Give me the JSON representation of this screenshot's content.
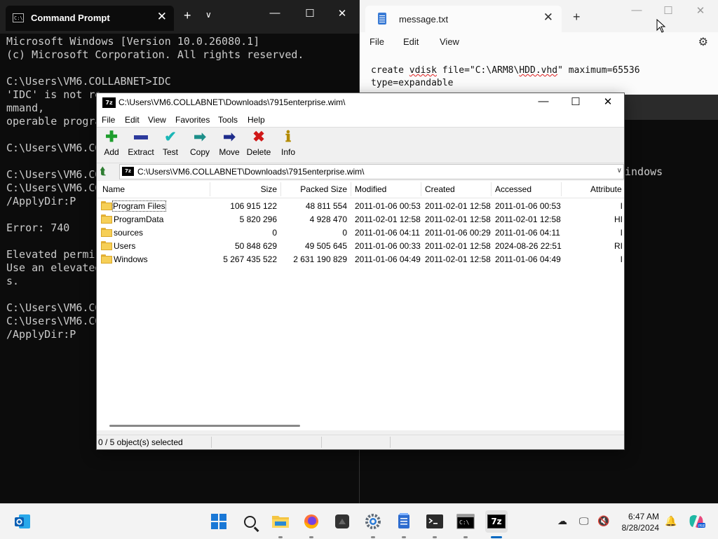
{
  "cmd": {
    "tab_title": "Command Prompt",
    "lines": [
      "Microsoft Windows [Version 10.0.26080.1]",
      "(c) Microsoft Corporation. All rights reserved.",
      "",
      "C:\\Users\\VM6.COLLABNET>IDC",
      "'IDC' is not re",
      "mmand,",
      "operable progra",
      "",
      "C:\\Users\\VM6.CO",
      "",
      "C:\\Users\\VM6.CO",
      "C:\\Users\\VM6.CO",
      "/ApplyDir:P",
      "",
      "Error: 740",
      "",
      "Elevated permis",
      "Use an elevated",
      "s.",
      "",
      "C:\\Users\\VM6.CO",
      "C:\\Users\\VM6.CO",
      "/ApplyDir:P"
    ],
    "partial_right_text": "indows"
  },
  "notepad": {
    "tab_title": "message.txt",
    "menu": [
      "File",
      "Edit",
      "View"
    ],
    "line1_pre": "create ",
    "line1_word1": "vdisk",
    "line1_mid": " file=\"C:\\ARM8\\",
    "line1_word2": "HDD.vhd",
    "line1_post": "\" maximum=65536",
    "line2": "type=expandable"
  },
  "sevenzip": {
    "title": "C:\\Users\\VM6.COLLABNET\\Downloads\\7915enterprise.wim\\",
    "menu": [
      "File",
      "Edit",
      "View",
      "Favorites",
      "Tools",
      "Help"
    ],
    "toolbar": [
      {
        "label": "Add",
        "icon": "plus-icon"
      },
      {
        "label": "Extract",
        "icon": "minus-icon"
      },
      {
        "label": "Test",
        "icon": "check-icon"
      },
      {
        "label": "Copy",
        "icon": "copy-arrow-icon"
      },
      {
        "label": "Move",
        "icon": "move-arrow-icon"
      },
      {
        "label": "Delete",
        "icon": "x-icon"
      },
      {
        "label": "Info",
        "icon": "info-icon"
      }
    ],
    "address": "C:\\Users\\VM6.COLLABNET\\Downloads\\7915enterprise.wim\\",
    "columns": [
      "Name",
      "Size",
      "Packed Size",
      "Modified",
      "Created",
      "Accessed",
      "Attribute"
    ],
    "rows": [
      {
        "name": "Program Files",
        "size": "106 915 122",
        "packed": "48 811 554",
        "modified": "2011-01-06 00:53",
        "created": "2011-02-01 12:58",
        "accessed": "2011-01-06 00:53",
        "attr": "I"
      },
      {
        "name": "ProgramData",
        "size": "5 820 296",
        "packed": "4 928 470",
        "modified": "2011-02-01 12:58",
        "created": "2011-02-01 12:58",
        "accessed": "2011-02-01 12:58",
        "attr": "HI"
      },
      {
        "name": "sources",
        "size": "0",
        "packed": "0",
        "modified": "2011-01-06 04:11",
        "created": "2011-01-06 00:29",
        "accessed": "2011-01-06 04:11",
        "attr": "I"
      },
      {
        "name": "Users",
        "size": "50 848 629",
        "packed": "49 505 645",
        "modified": "2011-01-06 00:33",
        "created": "2011-02-01 12:58",
        "accessed": "2024-08-26 22:51",
        "attr": "RI"
      },
      {
        "name": "Windows",
        "size": "5 267 435 522",
        "packed": "2 631 190 829",
        "modified": "2011-01-06 04:49",
        "created": "2011-02-01 12:58",
        "accessed": "2011-01-06 04:49",
        "attr": "I"
      }
    ],
    "status": "0 / 5 object(s) selected"
  },
  "taskbar": {
    "time": "6:47 AM",
    "date": "8/28/2024"
  }
}
